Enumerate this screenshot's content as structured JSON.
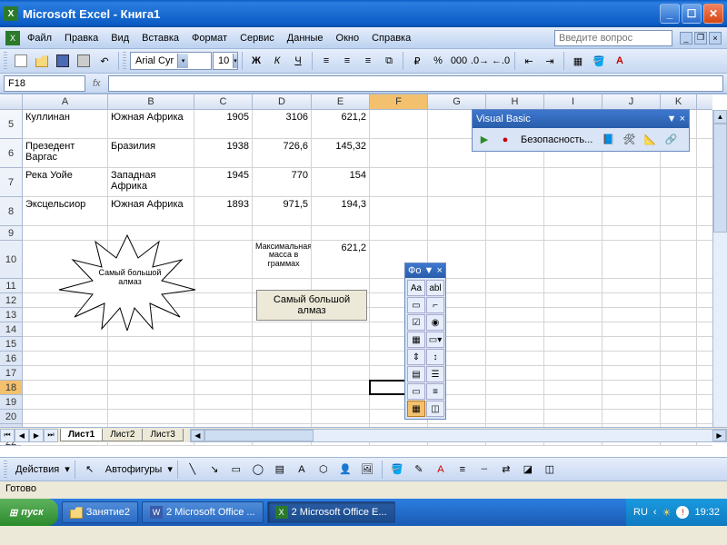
{
  "title": "Microsoft Excel - Книга1",
  "menubar": [
    "Файл",
    "Правка",
    "Вид",
    "Вставка",
    "Формат",
    "Сервис",
    "Данные",
    "Окно",
    "Справка"
  ],
  "askbox_placeholder": "Введите вопрос",
  "font": {
    "name": "Arial Cyr",
    "size": "10"
  },
  "namebox": "F18",
  "columns": [
    "A",
    "B",
    "C",
    "D",
    "E",
    "F",
    "G",
    "H",
    "I",
    "J",
    "K"
  ],
  "row_heights": {
    "5": 32,
    "6": 32,
    "7": 32,
    "8": 32,
    "9": 16,
    "10": 42,
    "11": 16,
    "12": 16,
    "13": 16,
    "14": 16,
    "15": 16,
    "16": 16,
    "17": 16,
    "18": 16,
    "19": 16,
    "20": 16,
    "21": 16,
    "22": 8
  },
  "rows": {
    "5": {
      "A": "Куллинан",
      "B": "Южная Африка",
      "C": "1905",
      "D": "3106",
      "E": "621,2"
    },
    "6": {
      "A": "Презедент Варгас",
      "B": "Бразилия",
      "C": "1938",
      "D": "726,6",
      "E": "145,32"
    },
    "7": {
      "A": "Река Уойе",
      "B": "Западная Африка",
      "C": "1945",
      "D": "770",
      "E": "154"
    },
    "8": {
      "A": "Эксцельсиор",
      "B": "Южная Африка",
      "C": "1893",
      "D": "971,5",
      "E": "194,3"
    },
    "10": {
      "D": "Максимальная масса в граммах",
      "E": "621,2"
    }
  },
  "active_cell": "F18",
  "star_text": "Самый большой алмаз",
  "button_text": "Самый большой алмаз",
  "vb_toolbar": {
    "title": "Visual Basic",
    "item": "Безопасность..."
  },
  "toolbox": {
    "title": "Фо ▼ ×",
    "items": [
      "Aa",
      "abl",
      "▭",
      "⌐",
      "☑",
      "◉",
      "▦",
      "▭▾",
      "⇕",
      "↕",
      "▤",
      "☰",
      "▭",
      "≡",
      "▦",
      "◫"
    ]
  },
  "sheet_tabs": [
    "Лист1",
    "Лист2",
    "Лист3"
  ],
  "active_tab": 0,
  "drawbar_label": "Действия",
  "autoshapes_label": "Автофигуры",
  "status": "Готово",
  "taskbar": {
    "start": "пуск",
    "buttons": [
      "Занятие2",
      "2 Microsoft Office ...",
      "2 Microsoft Office E..."
    ],
    "lang": "RU",
    "time": "19:32"
  }
}
